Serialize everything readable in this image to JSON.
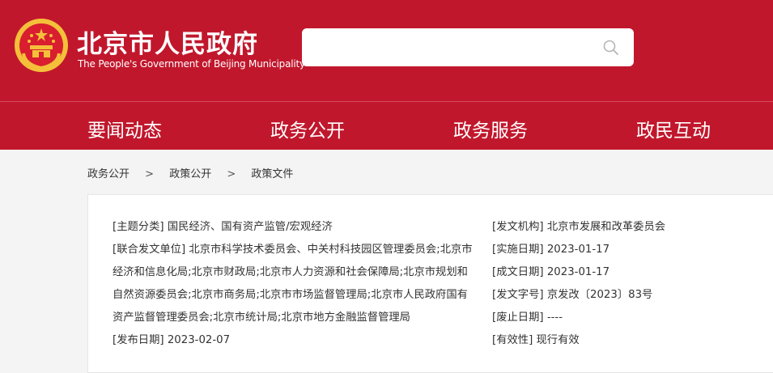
{
  "header": {
    "title": "北京市人民政府",
    "subtitle": "The People's Government of Beijing Municipality",
    "search": {
      "value": "",
      "placeholder": ""
    },
    "colors": {
      "brand_red": "#c1172c",
      "emblem_gold": "#f4c03a"
    }
  },
  "nav": {
    "items": [
      {
        "label": "要闻动态"
      },
      {
        "label": "政务公开"
      },
      {
        "label": "政务服务"
      },
      {
        "label": "政民互动"
      }
    ]
  },
  "breadcrumb": {
    "items": [
      "政务公开",
      "政策公开",
      "政策文件"
    ],
    "separator": ">"
  },
  "document_meta": {
    "left": {
      "topic": {
        "label": "[主题分类]",
        "value": "国民经济、国有资产监管/宏观经济"
      },
      "co_issuers": {
        "label": "[联合发文单位]",
        "lines": [
          "北京市科学技术委员会、中关村科技园区管理委员会;北京市",
          "经济和信息化局;北京市财政局;北京市人力资源和社会保障局;北京市规划和",
          "自然资源委员会;北京市商务局;北京市市场监督管理局;北京市人民政府国有",
          "资产监督管理委员会;北京市统计局;北京市地方金融监督管理局"
        ]
      },
      "publish_date": {
        "label": "[发布日期]",
        "value": "2023-02-07"
      }
    },
    "right": {
      "issuer": {
        "label": "[发文机构]",
        "value": "北京市发展和改革委员会"
      },
      "effective_date": {
        "label": "[实施日期]",
        "value": "2023-01-17"
      },
      "written_date": {
        "label": "[成文日期]",
        "value": "2023-01-17"
      },
      "doc_number": {
        "label": "[发文字号]",
        "value": "京发改〔2023〕83号"
      },
      "repeal_date": {
        "label": "[废止日期]",
        "value": "----"
      },
      "validity": {
        "label": "[有效性]",
        "value": "现行有效"
      }
    }
  }
}
